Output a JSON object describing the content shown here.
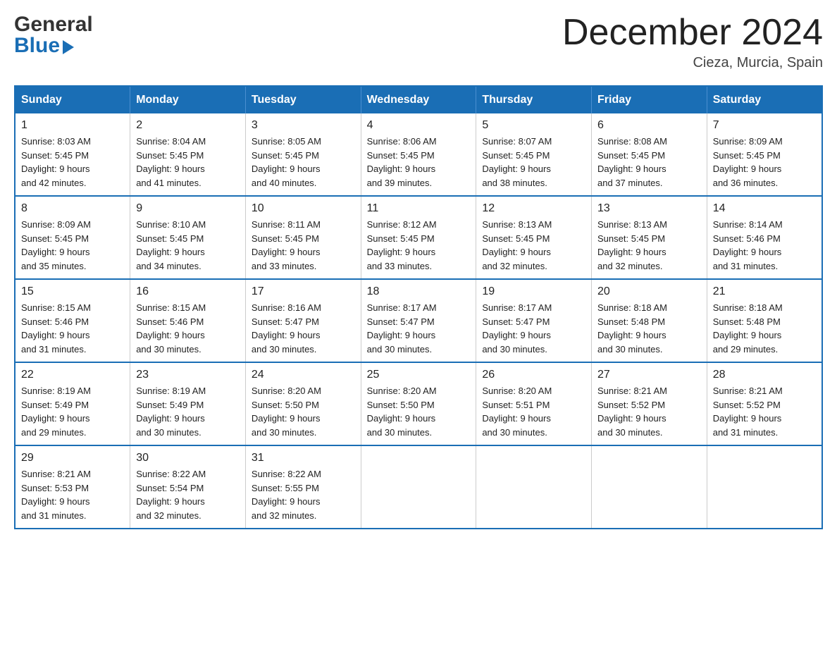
{
  "header": {
    "logo_general": "General",
    "logo_blue": "Blue",
    "month_title": "December 2024",
    "location": "Cieza, Murcia, Spain"
  },
  "days_of_week": [
    "Sunday",
    "Monday",
    "Tuesday",
    "Wednesday",
    "Thursday",
    "Friday",
    "Saturday"
  ],
  "weeks": [
    [
      {
        "day": "1",
        "sunrise": "8:03 AM",
        "sunset": "5:45 PM",
        "daylight": "9 hours and 42 minutes."
      },
      {
        "day": "2",
        "sunrise": "8:04 AM",
        "sunset": "5:45 PM",
        "daylight": "9 hours and 41 minutes."
      },
      {
        "day": "3",
        "sunrise": "8:05 AM",
        "sunset": "5:45 PM",
        "daylight": "9 hours and 40 minutes."
      },
      {
        "day": "4",
        "sunrise": "8:06 AM",
        "sunset": "5:45 PM",
        "daylight": "9 hours and 39 minutes."
      },
      {
        "day": "5",
        "sunrise": "8:07 AM",
        "sunset": "5:45 PM",
        "daylight": "9 hours and 38 minutes."
      },
      {
        "day": "6",
        "sunrise": "8:08 AM",
        "sunset": "5:45 PM",
        "daylight": "9 hours and 37 minutes."
      },
      {
        "day": "7",
        "sunrise": "8:09 AM",
        "sunset": "5:45 PM",
        "daylight": "9 hours and 36 minutes."
      }
    ],
    [
      {
        "day": "8",
        "sunrise": "8:09 AM",
        "sunset": "5:45 PM",
        "daylight": "9 hours and 35 minutes."
      },
      {
        "day": "9",
        "sunrise": "8:10 AM",
        "sunset": "5:45 PM",
        "daylight": "9 hours and 34 minutes."
      },
      {
        "day": "10",
        "sunrise": "8:11 AM",
        "sunset": "5:45 PM",
        "daylight": "9 hours and 33 minutes."
      },
      {
        "day": "11",
        "sunrise": "8:12 AM",
        "sunset": "5:45 PM",
        "daylight": "9 hours and 33 minutes."
      },
      {
        "day": "12",
        "sunrise": "8:13 AM",
        "sunset": "5:45 PM",
        "daylight": "9 hours and 32 minutes."
      },
      {
        "day": "13",
        "sunrise": "8:13 AM",
        "sunset": "5:45 PM",
        "daylight": "9 hours and 32 minutes."
      },
      {
        "day": "14",
        "sunrise": "8:14 AM",
        "sunset": "5:46 PM",
        "daylight": "9 hours and 31 minutes."
      }
    ],
    [
      {
        "day": "15",
        "sunrise": "8:15 AM",
        "sunset": "5:46 PM",
        "daylight": "9 hours and 31 minutes."
      },
      {
        "day": "16",
        "sunrise": "8:15 AM",
        "sunset": "5:46 PM",
        "daylight": "9 hours and 30 minutes."
      },
      {
        "day": "17",
        "sunrise": "8:16 AM",
        "sunset": "5:47 PM",
        "daylight": "9 hours and 30 minutes."
      },
      {
        "day": "18",
        "sunrise": "8:17 AM",
        "sunset": "5:47 PM",
        "daylight": "9 hours and 30 minutes."
      },
      {
        "day": "19",
        "sunrise": "8:17 AM",
        "sunset": "5:47 PM",
        "daylight": "9 hours and 30 minutes."
      },
      {
        "day": "20",
        "sunrise": "8:18 AM",
        "sunset": "5:48 PM",
        "daylight": "9 hours and 30 minutes."
      },
      {
        "day": "21",
        "sunrise": "8:18 AM",
        "sunset": "5:48 PM",
        "daylight": "9 hours and 29 minutes."
      }
    ],
    [
      {
        "day": "22",
        "sunrise": "8:19 AM",
        "sunset": "5:49 PM",
        "daylight": "9 hours and 29 minutes."
      },
      {
        "day": "23",
        "sunrise": "8:19 AM",
        "sunset": "5:49 PM",
        "daylight": "9 hours and 30 minutes."
      },
      {
        "day": "24",
        "sunrise": "8:20 AM",
        "sunset": "5:50 PM",
        "daylight": "9 hours and 30 minutes."
      },
      {
        "day": "25",
        "sunrise": "8:20 AM",
        "sunset": "5:50 PM",
        "daylight": "9 hours and 30 minutes."
      },
      {
        "day": "26",
        "sunrise": "8:20 AM",
        "sunset": "5:51 PM",
        "daylight": "9 hours and 30 minutes."
      },
      {
        "day": "27",
        "sunrise": "8:21 AM",
        "sunset": "5:52 PM",
        "daylight": "9 hours and 30 minutes."
      },
      {
        "day": "28",
        "sunrise": "8:21 AM",
        "sunset": "5:52 PM",
        "daylight": "9 hours and 31 minutes."
      }
    ],
    [
      {
        "day": "29",
        "sunrise": "8:21 AM",
        "sunset": "5:53 PM",
        "daylight": "9 hours and 31 minutes."
      },
      {
        "day": "30",
        "sunrise": "8:22 AM",
        "sunset": "5:54 PM",
        "daylight": "9 hours and 32 minutes."
      },
      {
        "day": "31",
        "sunrise": "8:22 AM",
        "sunset": "5:55 PM",
        "daylight": "9 hours and 32 minutes."
      },
      null,
      null,
      null,
      null
    ]
  ],
  "labels": {
    "sunrise": "Sunrise:",
    "sunset": "Sunset:",
    "daylight": "Daylight:"
  }
}
